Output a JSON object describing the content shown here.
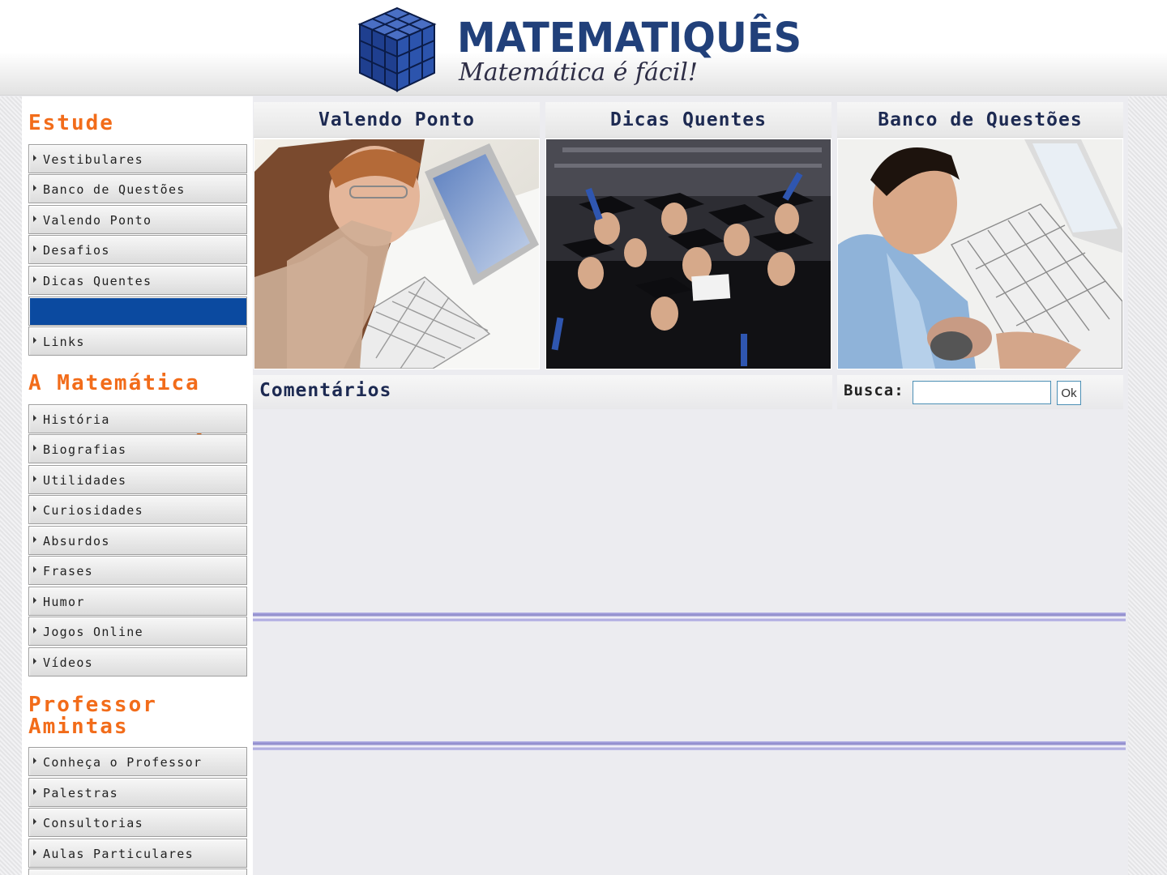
{
  "header": {
    "title": "MATEMATIQUÊS",
    "tagline": "Matemática é fácil!"
  },
  "sidebar": {
    "sections": [
      {
        "title": "Estude",
        "items": [
          "Vestibulares",
          "Banco de Questões",
          "Valendo Ponto",
          "Desafios",
          "Dicas Quentes",
          "",
          "Links"
        ]
      },
      {
        "title": "A Matemática",
        "items": [
          "História",
          "Biografias",
          "Utilidades",
          "Curiosidades",
          "Absurdos",
          "Frases",
          "Humor",
          "Jogos Online",
          "Vídeos"
        ]
      },
      {
        "title_line1": "Professor",
        "title_line2": "Amintas",
        "items": [
          "Conheça o Professor",
          "Palestras",
          "Consultorias",
          "Aulas Particulares"
        ]
      }
    ]
  },
  "cards": [
    {
      "title": "Valendo Ponto",
      "image": "woman-with-laptop-photo"
    },
    {
      "title": "Dicas Quentes",
      "image": "graduates-celebrating-photo"
    },
    {
      "title": "Banco de Questões",
      "image": "man-at-computer-photo"
    }
  ],
  "comments": {
    "title": "Comentários"
  },
  "search": {
    "label": "Busca:",
    "value": "",
    "button_label": "Ok"
  },
  "colors": {
    "brand_navy": "#21407a",
    "section_orange": "#f26c1a",
    "active_blue": "#0b4aa0",
    "divider_lavender": "#a9a6dc"
  }
}
